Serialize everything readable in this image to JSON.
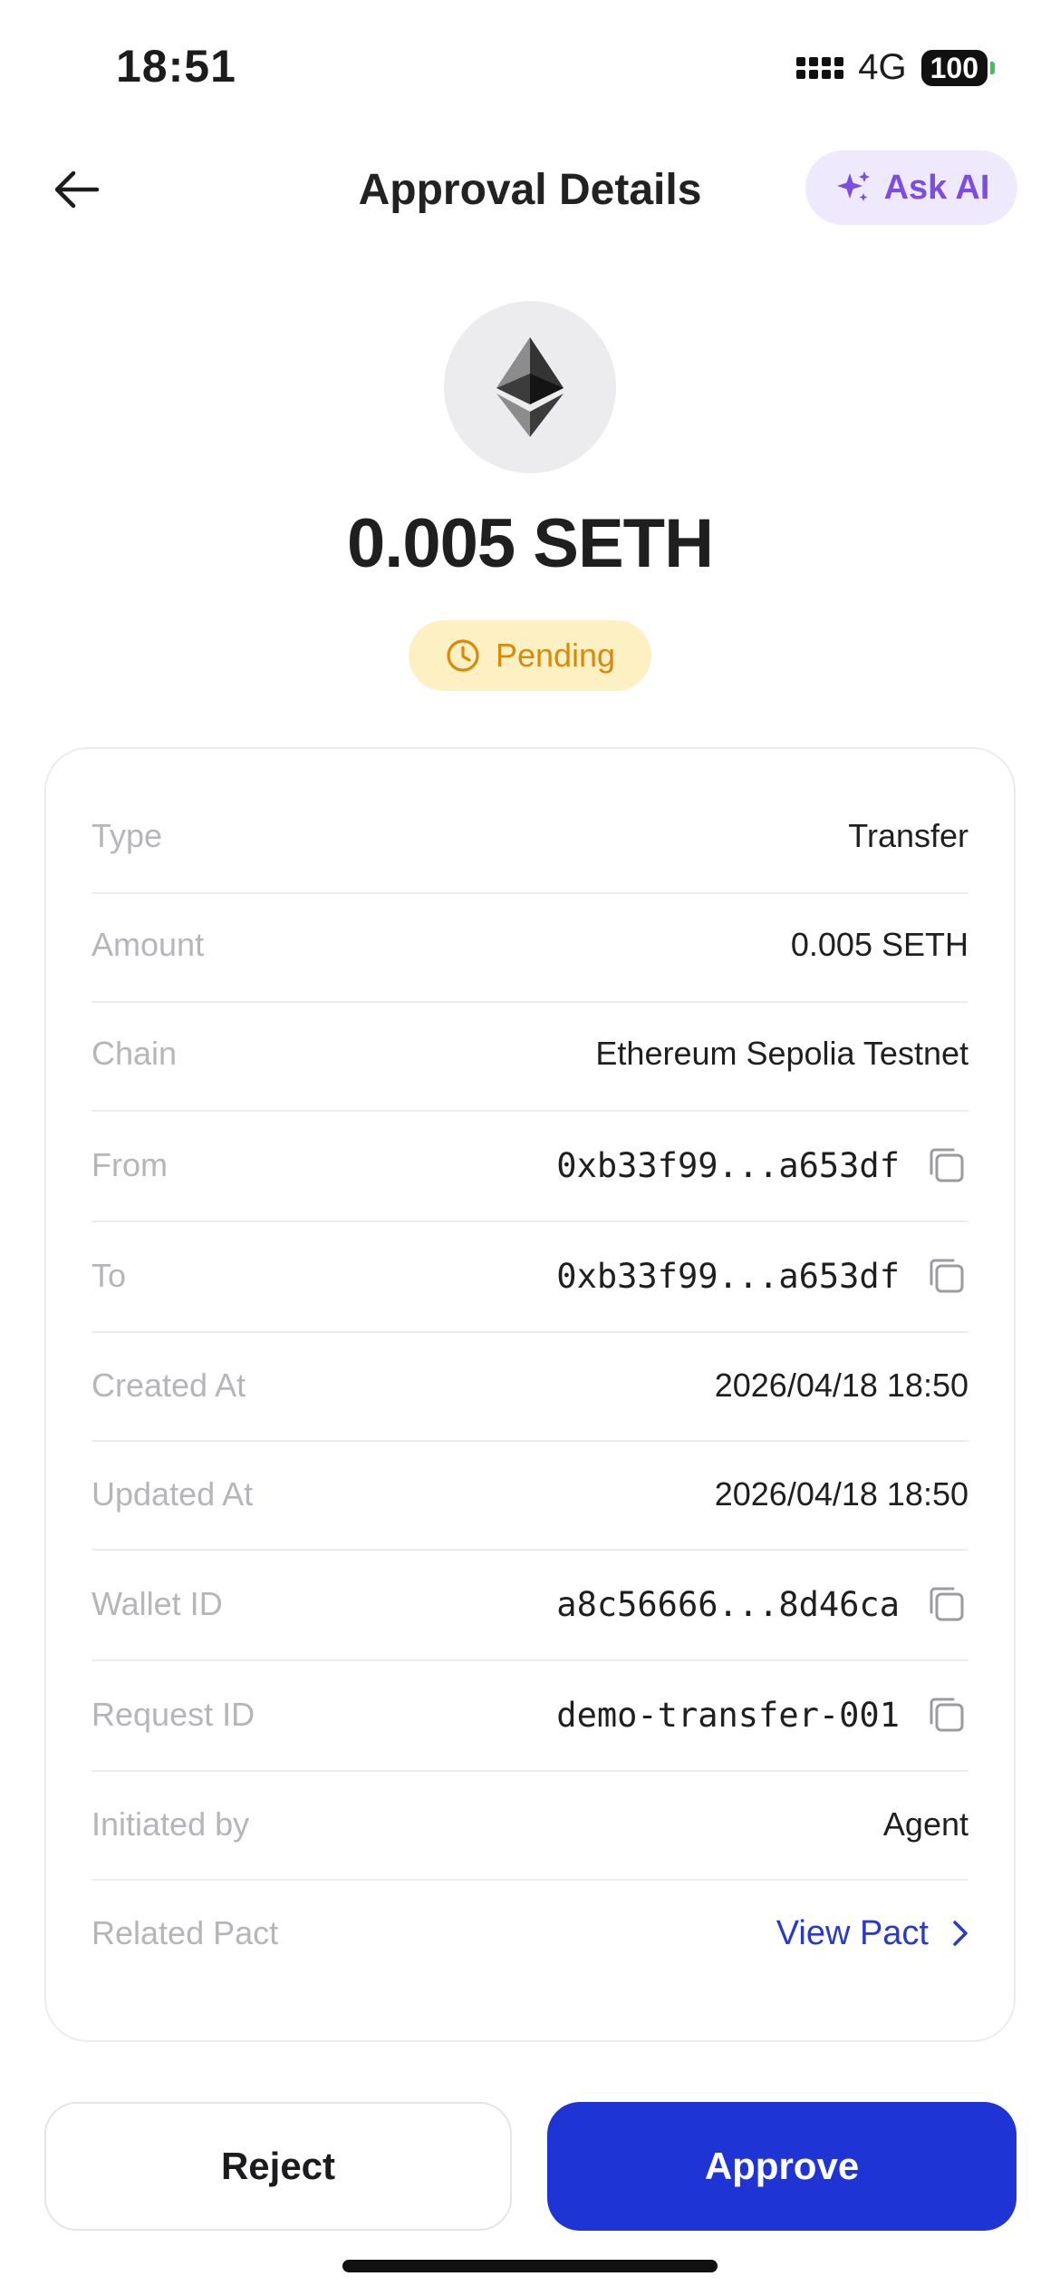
{
  "status_bar": {
    "time": "18:51",
    "network": "4G",
    "battery": "100"
  },
  "header": {
    "title": "Approval Details",
    "ask_ai_label": "Ask AI"
  },
  "hero": {
    "token_icon": "ethereum-icon",
    "amount": "0.005 SETH",
    "status": "Pending",
    "status_color": "#d88a0c"
  },
  "details": [
    {
      "label": "Type",
      "value": "Transfer"
    },
    {
      "label": "Amount",
      "value": "0.005 SETH"
    },
    {
      "label": "Chain",
      "value": "Ethereum Sepolia Testnet"
    },
    {
      "label": "From",
      "value": "0xb33f99...a653df"
    },
    {
      "label": "To",
      "value": "0xb33f99...a653df"
    },
    {
      "label": "Created At",
      "value": "2026/04/18 18:50"
    },
    {
      "label": "Updated At",
      "value": "2026/04/18 18:50"
    },
    {
      "label": "Wallet ID",
      "value": "a8c56666...8d46ca"
    },
    {
      "label": "Request ID",
      "value": "demo-transfer-001"
    },
    {
      "label": "Initiated by",
      "value": "Agent"
    },
    {
      "label": "Related Pact",
      "value": "View Pact"
    }
  ],
  "actions": {
    "reject_label": "Reject",
    "approve_label": "Approve"
  },
  "colors": {
    "accent": "#1f34d4",
    "ai_purple": "#7b4ee0",
    "pending_bg": "#fdf1c4",
    "link": "#2a3ac8"
  }
}
